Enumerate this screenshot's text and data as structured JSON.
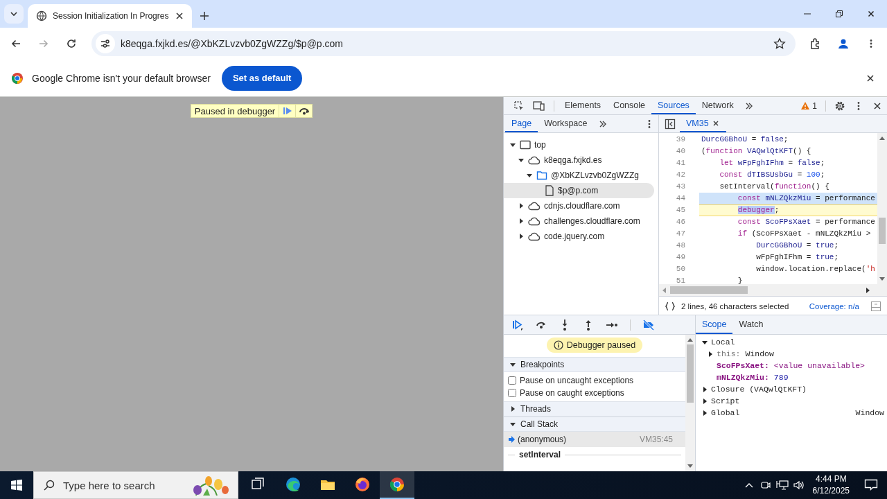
{
  "browser": {
    "tabs": [
      {
        "title": "Session Initialization In Progres",
        "selected": true
      }
    ],
    "address": "k8eqga.fxjkd.es/@XbKZLvzvb0ZgWZZg/$p@p.com",
    "infobar": {
      "message": "Google Chrome isn't your default browser",
      "button": "Set as default"
    },
    "page": {
      "overlay": "Paused in debugger"
    }
  },
  "devtools": {
    "panel_tabs": [
      {
        "label": "Elements",
        "selected": false
      },
      {
        "label": "Console",
        "selected": false
      },
      {
        "label": "Sources",
        "selected": true
      },
      {
        "label": "Network",
        "selected": false
      }
    ],
    "warnings": "1",
    "navigator": {
      "tabs": [
        {
          "label": "Page",
          "selected": true
        },
        {
          "label": "Workspace",
          "selected": false
        }
      ],
      "tree": [
        {
          "label": "top",
          "kind": "frame",
          "expanded": true,
          "selected": false,
          "children": [
            {
              "label": "k8eqga.fxjkd.es",
              "kind": "domain",
              "expanded": true,
              "selected": false,
              "children": [
                {
                  "label": "@XbKZLvzvb0ZgWZZg",
                  "kind": "folder",
                  "expanded": true,
                  "selected": false,
                  "children": [
                    {
                      "label": "$p@p.com",
                      "kind": "file",
                      "selected": true
                    }
                  ]
                }
              ]
            },
            {
              "label": "cdnjs.cloudflare.com",
              "kind": "domain",
              "expanded": false,
              "selected": false
            },
            {
              "label": "challenges.cloudflare.com",
              "kind": "domain",
              "expanded": false,
              "selected": false
            },
            {
              "label": "code.jquery.com",
              "kind": "domain",
              "expanded": false,
              "selected": false
            }
          ]
        }
      ]
    },
    "editor": {
      "tabs": [
        {
          "label": "VM35",
          "selected": true
        }
      ],
      "lines": [
        {
          "number": "39",
          "selected": false,
          "paused": false,
          "parts": [
            {
              "kind": "name",
              "text": "DurcGGBhoU"
            },
            {
              "kind": "plain",
              "text": " = "
            },
            {
              "kind": "atom",
              "text": "false"
            },
            {
              "kind": "plain",
              "text": ";"
            }
          ]
        },
        {
          "number": "40",
          "selected": false,
          "paused": false,
          "parts": [
            {
              "kind": "plain",
              "text": "("
            },
            {
              "kind": "keyword",
              "text": "function "
            },
            {
              "kind": "name",
              "text": "VAQwlQtKFT"
            },
            {
              "kind": "plain",
              "text": "() {"
            }
          ]
        },
        {
          "number": "41",
          "selected": false,
          "paused": false,
          "parts": [
            {
              "kind": "keyword",
              "text": "    let "
            },
            {
              "kind": "name",
              "text": "wFpFghIFhm"
            },
            {
              "kind": "plain",
              "text": " = "
            },
            {
              "kind": "atom",
              "text": "false"
            },
            {
              "kind": "plain",
              "text": ";"
            }
          ]
        },
        {
          "number": "42",
          "selected": false,
          "paused": false,
          "parts": [
            {
              "kind": "keyword",
              "text": "    const "
            },
            {
              "kind": "name",
              "text": "dTIBSUsbGu"
            },
            {
              "kind": "plain",
              "text": " = "
            },
            {
              "kind": "number",
              "text": "100"
            },
            {
              "kind": "plain",
              "text": ";"
            }
          ]
        },
        {
          "number": "43",
          "selected": false,
          "paused": false,
          "parts": [
            {
              "kind": "plain",
              "text": "    setInterval("
            },
            {
              "kind": "keyword",
              "text": "function"
            },
            {
              "kind": "plain",
              "text": "() {"
            }
          ]
        },
        {
          "number": "44",
          "selected": true,
          "paused": false,
          "parts": [
            {
              "kind": "keyword",
              "text": "        const "
            },
            {
              "kind": "name",
              "text": "mNLZQkzMiu"
            },
            {
              "kind": "plain",
              "text": " = performance"
            }
          ]
        },
        {
          "number": "45",
          "selected": false,
          "paused": true,
          "parts": [
            {
              "kind": "selected-keyword",
              "text": "        debugger"
            },
            {
              "kind": "plain",
              "text": ";"
            }
          ]
        },
        {
          "number": "46",
          "selected": false,
          "paused": false,
          "parts": [
            {
              "kind": "keyword",
              "text": "        const "
            },
            {
              "kind": "name",
              "text": "ScoFPsXaet"
            },
            {
              "kind": "plain",
              "text": " = performance"
            }
          ]
        },
        {
          "number": "47",
          "selected": false,
          "paused": false,
          "parts": [
            {
              "kind": "keyword",
              "text": "        if"
            },
            {
              "kind": "plain",
              "text": " (ScoFPsXaet - mNLZQkzMiu > "
            }
          ]
        },
        {
          "number": "48",
          "selected": false,
          "paused": false,
          "parts": [
            {
              "kind": "name",
              "text": "            DurcGGBhoU"
            },
            {
              "kind": "plain",
              "text": " = "
            },
            {
              "kind": "atom",
              "text": "true"
            },
            {
              "kind": "plain",
              "text": ";"
            }
          ]
        },
        {
          "number": "49",
          "selected": false,
          "paused": false,
          "parts": [
            {
              "kind": "plain",
              "text": "            wFpFghIFhm = "
            },
            {
              "kind": "atom",
              "text": "true"
            },
            {
              "kind": "plain",
              "text": ";"
            }
          ]
        },
        {
          "number": "50",
          "selected": false,
          "paused": false,
          "parts": [
            {
              "kind": "plain",
              "text": "            window.location.replace("
            },
            {
              "kind": "string",
              "text": "'h"
            }
          ]
        },
        {
          "number": "51",
          "selected": false,
          "paused": false,
          "parts": [
            {
              "kind": "plain",
              "text": "        }"
            }
          ]
        }
      ],
      "status": "2 lines, 46 characters selected",
      "coverage": "Coverage: n/a"
    },
    "debugger": {
      "banner": "Debugger paused",
      "sections": [
        {
          "title": "Breakpoints",
          "expanded": true,
          "options": [
            {
              "label": "Pause on uncaught exceptions",
              "checked": false
            },
            {
              "label": "Pause on caught exceptions",
              "checked": false
            }
          ]
        },
        {
          "title": "Threads",
          "expanded": false
        },
        {
          "title": "Call Stack",
          "expanded": true,
          "frames": [
            {
              "name": "(anonymous)",
              "location": "VM35:45",
              "kind": "frame",
              "selected": true
            },
            {
              "name": "setInterval",
              "kind": "async",
              "selected": false
            }
          ]
        }
      ]
    },
    "scope": {
      "tabs": [
        {
          "label": "Scope",
          "selected": true
        },
        {
          "label": "Watch",
          "selected": false
        }
      ],
      "tree": [
        {
          "name": "Local",
          "expanded": true,
          "children": [
            {
              "name": "this:",
              "value": "Window",
              "kind": "object",
              "expanded": false
            },
            {
              "name": "ScoFPsXaet:",
              "value": "<value unavailable>",
              "kind": "unavailable"
            },
            {
              "name": "mNLZQkzMiu:",
              "value": "789",
              "kind": "number"
            }
          ]
        },
        {
          "name": "Closure (VAQwlQtKFT)",
          "expanded": false
        },
        {
          "name": "Script",
          "expanded": false
        },
        {
          "name": "Global",
          "value": "Window",
          "expanded": false
        }
      ]
    }
  },
  "taskbar": {
    "search_placeholder": "Type here to search",
    "apps": [
      {
        "kind": "taskview",
        "selected": false
      },
      {
        "kind": "edge",
        "selected": false
      },
      {
        "kind": "files",
        "selected": false
      },
      {
        "kind": "firefox",
        "selected": false
      },
      {
        "kind": "chrome",
        "selected": true
      }
    ],
    "time": "4:44 PM",
    "date": "6/12/2025"
  }
}
